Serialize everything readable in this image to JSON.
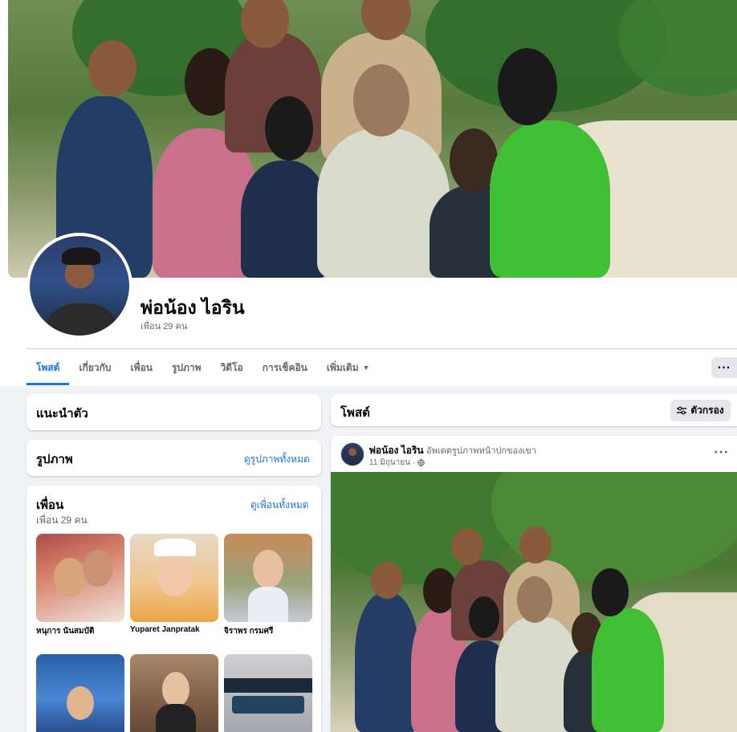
{
  "profile": {
    "name": "พ่อน้อง ไอริน",
    "friends_count": "เพื่อน 29 คน"
  },
  "tabs": [
    {
      "label": "โพสต์",
      "active": true
    },
    {
      "label": "เกี่ยวกับ",
      "active": false
    },
    {
      "label": "เพื่อน",
      "active": false
    },
    {
      "label": "รูปภาพ",
      "active": false
    },
    {
      "label": "วิดีโอ",
      "active": false
    },
    {
      "label": "การเช็คอิน",
      "active": false
    },
    {
      "label": "เพิ่มเติม",
      "active": false
    }
  ],
  "more_button": "···",
  "intro": {
    "title": "แนะนำตัว"
  },
  "photos": {
    "title": "รูปภาพ",
    "link": "ดูรูปภาพทั้งหมด"
  },
  "friends": {
    "title": "เพื่อน",
    "count": "เพื่อน 29 คน",
    "link": "ดูเพื่อนทั้งหมด",
    "items": [
      {
        "name": "หนุการ นันสมบัติ"
      },
      {
        "name": "Yuparet Janpratak"
      },
      {
        "name": "จิราพร กรมศรี"
      },
      {
        "name": ""
      },
      {
        "name": ""
      },
      {
        "name": ""
      }
    ]
  },
  "posts_header": {
    "title": "โพสต์",
    "filter_label": "ตัวกรอง"
  },
  "post": {
    "author": "พ่อน้อง ไอริน",
    "action": "อัพเดตรูปภาพหน้าปกของเขา",
    "date": "11 มิถุนายน ·",
    "menu": "···"
  },
  "colors": {
    "accent": "#1b74e4",
    "page_bg": "#f0f2f5",
    "muted_text": "#65676b"
  },
  "icons": [
    "globe-icon",
    "filter-icon",
    "caret-down-icon",
    "more-icon"
  ]
}
